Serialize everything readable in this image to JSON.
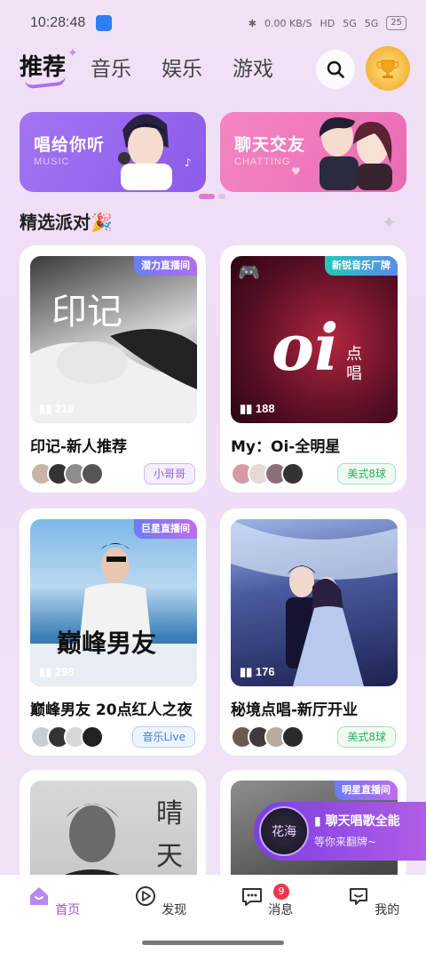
{
  "status_bar": {
    "time": "10:28:48",
    "net_speed": "0.00 KB/S",
    "hd": "HD",
    "signal1": "5G",
    "signal2": "5G",
    "battery": "25"
  },
  "tabs": [
    {
      "label": "推荐",
      "active": true
    },
    {
      "label": "音乐",
      "active": false
    },
    {
      "label": "娱乐",
      "active": false
    },
    {
      "label": "游戏",
      "active": false
    }
  ],
  "banners": [
    {
      "title": "唱给你听",
      "subtitle": "MUSIC"
    },
    {
      "title": "聊天交友",
      "subtitle": "CHATTING"
    }
  ],
  "section_title": "精选派对",
  "rooms": [
    {
      "name": "印记-新人推荐",
      "listeners": "216",
      "badge": "潜力直播间",
      "tag": "小哥哥",
      "tag_color": "purple",
      "cover_text": "印记"
    },
    {
      "name": "My：Oi-全明星",
      "listeners": "188",
      "badge": "新锐音乐厂牌",
      "tag": "美式8球",
      "tag_color": "green",
      "cover_text": "oi",
      "cover_sub": "点唱"
    },
    {
      "name": "巅峰男友 20点红人之夜",
      "listeners": "298",
      "badge": "巨星直播间",
      "tag": "音乐Live",
      "tag_color": "blue",
      "cover_text": "巅峰男友"
    },
    {
      "name": "秘境点唱-新厅开业",
      "listeners": "176",
      "badge": "",
      "tag": "美式8球",
      "tag_color": "green"
    },
    {
      "name": "",
      "listeners": "",
      "badge": "",
      "cover_text": "晴天"
    },
    {
      "name": "",
      "listeners": "",
      "badge": "明星直播间",
      "cover_text": ""
    }
  ],
  "float_widget": {
    "title": "聊天唱歌全能",
    "subtitle": "等你来翻牌~",
    "disc_text": "花海"
  },
  "bottom_nav": [
    {
      "label": "首页",
      "active": true
    },
    {
      "label": "发现",
      "active": false
    },
    {
      "label": "消息",
      "active": false,
      "badge": "9"
    },
    {
      "label": "我的",
      "active": false
    }
  ]
}
